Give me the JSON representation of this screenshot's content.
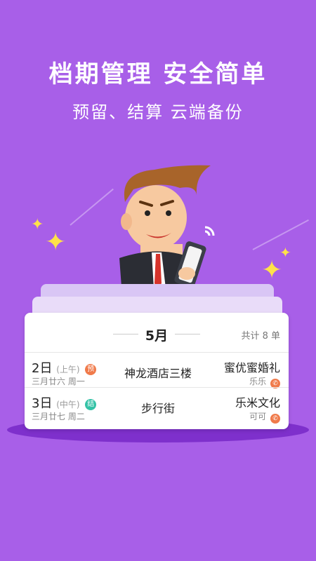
{
  "headline": "档期管理 安全简单",
  "subline": "预留、结算 云端备份",
  "card": {
    "month": "5月",
    "total": "共计 8 单",
    "rows": [
      {
        "day": "2日",
        "ampm": "(上午)",
        "badge": "预",
        "badge_color": "#f07a4a",
        "lunar": "三月廿六 周一",
        "venue": "神龙酒店三楼",
        "client": "蜜优蜜婚礼",
        "contact": "乐乐"
      },
      {
        "day": "3日",
        "ampm": "(中午)",
        "badge": "结",
        "badge_color": "#34c2a6",
        "lunar": "三月廿七 周二",
        "venue": "步行街",
        "client": "乐米文化",
        "contact": "可可"
      }
    ]
  },
  "colors": {
    "background": "#a85fe8",
    "sparkle": "#ffe14a",
    "phone_icon": "#f07a4a"
  }
}
